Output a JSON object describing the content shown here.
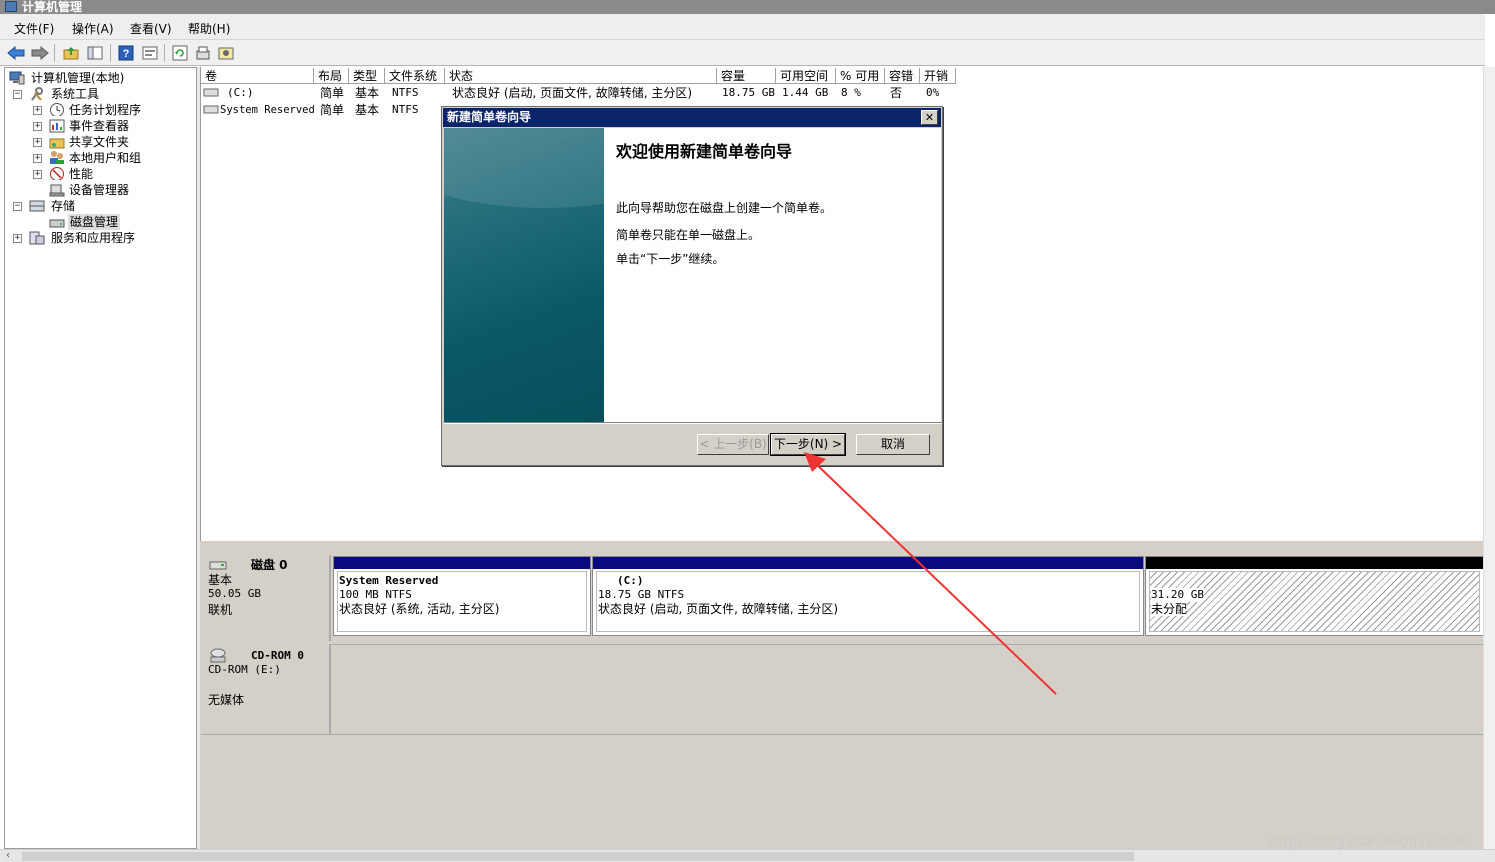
{
  "window": {
    "title": "计算机管理"
  },
  "menu": [
    "文件(F)",
    "操作(A)",
    "查看(V)",
    "帮助(H)"
  ],
  "toolbar_icons": [
    "back-icon",
    "forward-icon",
    "up-folder-icon",
    "show-hide-tree-icon",
    "help-icon",
    "properties-icon",
    "refresh-icon",
    "export-icon",
    "settings-icon"
  ],
  "tree": {
    "root": "计算机管理(本地)",
    "system_tools": "系统工具",
    "task_scheduler": "任务计划程序",
    "event_viewer": "事件查看器",
    "shared_folders": "共享文件夹",
    "local_users": "本地用户和组",
    "performance": "性能",
    "device_manager": "设备管理器",
    "storage": "存储",
    "disk_management": "磁盘管理",
    "services_apps": "服务和应用程序"
  },
  "volume_table": {
    "headers": [
      "卷",
      "布局",
      "类型",
      "文件系统",
      "状态",
      "容量",
      "可用空间",
      "% 可用",
      "容错",
      "开销"
    ],
    "rows": [
      {
        "volume": "(C:)",
        "layout": "简单",
        "type": "基本",
        "fs": "NTFS",
        "status": "状态良好 (启动, 页面文件, 故障转储, 主分区)",
        "capacity": "18.75 GB",
        "free": "1.44 GB",
        "pct_free": "8 %",
        "fault_tolerance": "否",
        "overhead": "0%"
      },
      {
        "volume": "System Reserved",
        "layout": "简单",
        "type": "基本",
        "fs": "NTFS"
      }
    ]
  },
  "disks": {
    "disk0": {
      "name": "磁盘 0",
      "kind": "基本",
      "size": "50.05 GB",
      "state": "联机",
      "partitions": [
        {
          "title": "System Reserved",
          "size_fs": "100 MB NTFS",
          "status": "状态良好 (系统, 活动, 主分区)"
        },
        {
          "title": "(C:)",
          "size_fs": "18.75 GB NTFS",
          "status": "状态良好 (启动, 页面文件, 故障转储, 主分区)"
        },
        {
          "title": "",
          "size_fs": "31.20 GB",
          "status": "未分配"
        }
      ]
    },
    "cdrom0": {
      "name": "CD-ROM 0",
      "drive": "CD-ROM (E:)",
      "state": "无媒体"
    }
  },
  "wizard": {
    "title": "新建简单卷向导",
    "close": "✕",
    "heading": "欢迎使用新建简单卷向导",
    "p1": "此向导帮助您在磁盘上创建一个简单卷。",
    "p2": "简单卷只能在单一磁盘上。",
    "p3": "单击“下一步”继续。",
    "back_label": "< 上一步(B)",
    "next_label": "下一步(N) >",
    "cancel_label": "取消"
  },
  "watermark": "https://blog.csdn.net/daxia5a0",
  "colors": {
    "title_bar": "#0a246a",
    "partition_bar": "#0a0a7e",
    "annotation_arrow": "#ee3333",
    "wizard_side": "#0a5867"
  }
}
